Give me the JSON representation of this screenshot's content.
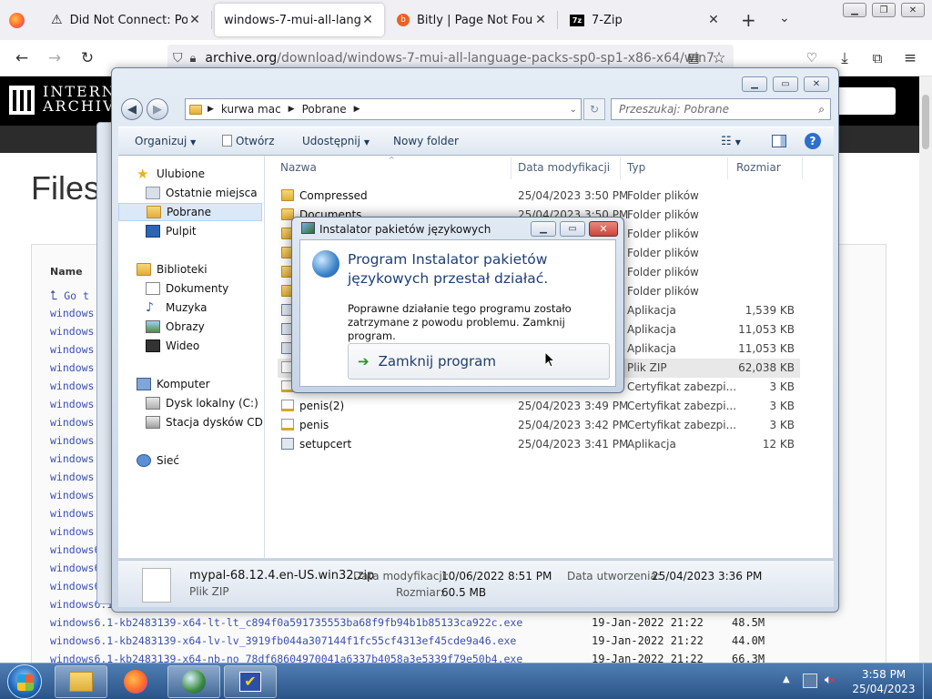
{
  "browser": {
    "tabs": [
      {
        "title": "Did Not Connect: Potent",
        "active": false
      },
      {
        "title": "windows-7-mui-all-language",
        "active": true
      },
      {
        "title": "Bitly | Page Not Found | 4",
        "active": false
      },
      {
        "title": "7-Zip",
        "active": false
      }
    ],
    "url_host": "archive.org",
    "url_path": "/download/windows-7-mui-all-language-packs-sp0-sp1-x86-x64/win7"
  },
  "archive": {
    "logo_line1": "INTERN",
    "logo_line2": "ARCHIVE",
    "page_title": "Files",
    "name_header": "Name",
    "go_up": "Go t",
    "left_links": [
      "windows",
      "windows",
      "windows",
      "windows",
      "windows",
      "windows",
      "windows",
      "windows",
      "windows",
      "windows",
      "windows",
      "windows",
      "windows"
    ],
    "partial_links": [
      "windows6.1",
      "windows6.1",
      "windows6.1",
      "windows6.1"
    ],
    "full_rows": [
      {
        "name": "windows6.1-kb2483139-x64-lt-lt_c894f0a591735553ba68f9fb94b1b85133ca922c.exe",
        "date": "19-Jan-2022 21:22",
        "size": "48.5M"
      },
      {
        "name": "windows6.1-kb2483139-x64-lv-lv_3919fb044a307144f1fc55cf4313ef45cde9a46.exe",
        "date": "19-Jan-2022 21:22",
        "size": "44.0M"
      },
      {
        "name": "windows6.1-kb2483139-x64-nb-no_78df68604970041a6337b4058a3e5339f79e50b4.exe",
        "date": "19-Jan-2022 21:22",
        "size": "66.3M"
      }
    ]
  },
  "explorer": {
    "address": [
      "kurwa mac",
      "Pobrane"
    ],
    "search_placeholder": "Przeszukaj: Pobrane",
    "toolbar": {
      "organize": "Organizuj",
      "open": "Otwórz",
      "share": "Udostępnij",
      "new_folder": "Nowy folder"
    },
    "nav": {
      "favorites": "Ulubione",
      "recent": "Ostatnie miejsca",
      "downloads": "Pobrane",
      "desktop": "Pulpit",
      "libraries": "Biblioteki",
      "documents": "Dokumenty",
      "music": "Muzyka",
      "pictures": "Obrazy",
      "video": "Wideo",
      "computer": "Komputer",
      "local_disk": "Dysk lokalny (C:)",
      "cd_drive": "Stacja dysków CD (D",
      "network": "Sieć"
    },
    "columns": {
      "name": "Nazwa",
      "date": "Data modyfikacji",
      "type": "Typ",
      "size": "Rozmiar"
    },
    "rows": [
      {
        "name": "Compressed",
        "date": "25/04/2023 3:50 PM",
        "type": "Folder plików",
        "size": ""
      },
      {
        "name": "Documents",
        "date": "25/04/2023 3:50 PM",
        "type": "Folder plików",
        "size": ""
      },
      {
        "name": "",
        "date": "",
        "type": "Folder plików",
        "size": ""
      },
      {
        "name": "",
        "date": "",
        "type": "Folder plików",
        "size": ""
      },
      {
        "name": "",
        "date": "",
        "type": "Folder plików",
        "size": ""
      },
      {
        "name": "",
        "date": "",
        "type": "Folder plików",
        "size": ""
      },
      {
        "name": "",
        "date": "",
        "type": "Aplikacja",
        "size": "1,539 KB"
      },
      {
        "name": "",
        "date": "",
        "type": "Aplikacja",
        "size": "11,053 KB"
      },
      {
        "name": "",
        "date": "",
        "type": "Aplikacja",
        "size": "11,053 KB"
      },
      {
        "name": "",
        "date": "",
        "type": "Plik ZIP",
        "size": "62,038 KB"
      },
      {
        "name": "",
        "date": "",
        "type": "Certyfikat zabezpi...",
        "size": "3 KB"
      },
      {
        "name": "penis(2)",
        "date": "25/04/2023 3:49 PM",
        "type": "Certyfikat zabezpi...",
        "size": "3 KB"
      },
      {
        "name": "penis",
        "date": "25/04/2023 3:42 PM",
        "type": "Certyfikat zabezpi...",
        "size": "3 KB"
      },
      {
        "name": "setupcert",
        "date": "25/04/2023 3:41 PM",
        "type": "Aplikacja",
        "size": "12 KB"
      }
    ],
    "details": {
      "file_name": "mypal-68.12.4.en-US.win32.zip",
      "file_type": "Plik ZIP",
      "modified_label": "Data modyfikacji:",
      "modified_value": "10/06/2022 8:51 PM",
      "created_label": "Data utworzenia:",
      "created_value": "25/04/2023 3:36 PM",
      "size_label": "Rozmiar:",
      "size_value": "60.5 MB"
    }
  },
  "dialog": {
    "title": "Instalator pakietów językowych",
    "heading": "Program Instalator pakietów językowych przestał działać.",
    "message": "Poprawne działanie tego programu zostało zatrzymane z powodu problemu. Zamknij program.",
    "button": "Zamknij program"
  },
  "taskbar": {
    "time": "3:58 PM",
    "date": "25/04/2023"
  },
  "colors": {
    "taskbar": "#2a5488",
    "link": "#3a4fb5",
    "explorer_frame": "#c9d6e6",
    "close_red": "#c9463d"
  }
}
